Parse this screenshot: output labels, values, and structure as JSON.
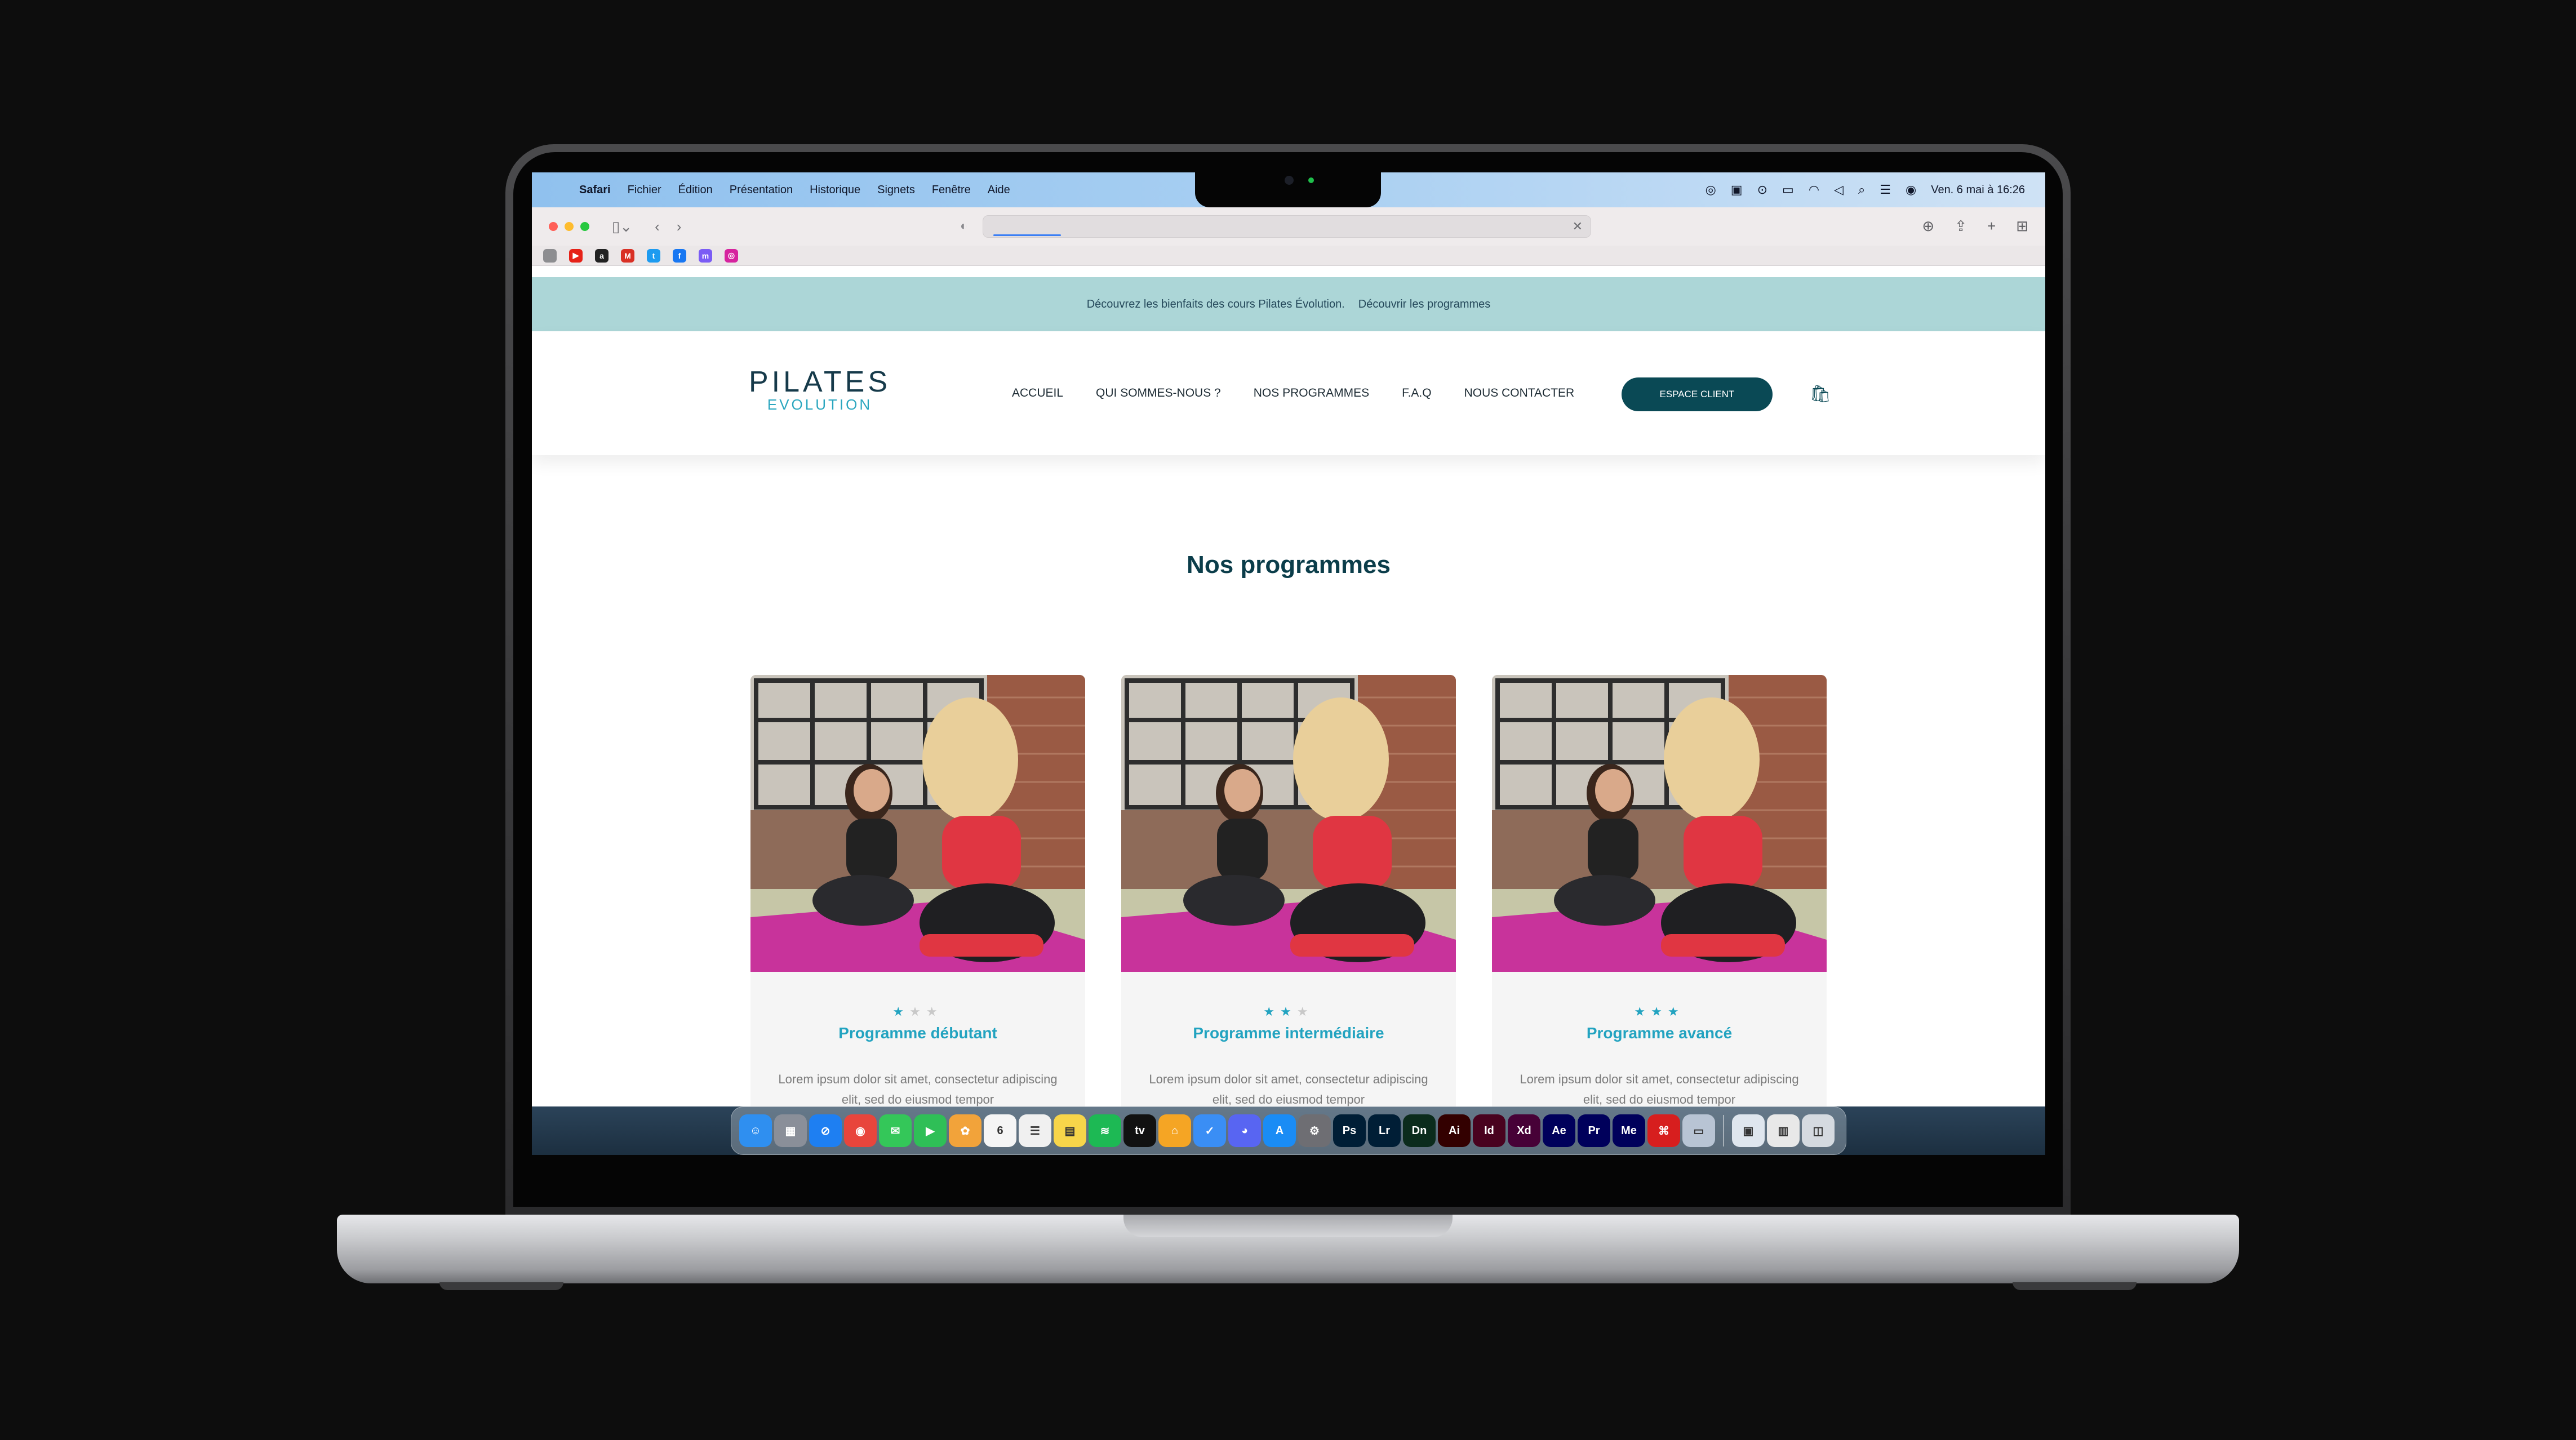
{
  "menubar": {
    "app": "Safari",
    "items": [
      "Fichier",
      "Édition",
      "Présentation",
      "Historique",
      "Signets",
      "Fenêtre",
      "Aide"
    ],
    "clock": "Ven. 6 mai à  16:26"
  },
  "favorites": [
    {
      "name": "apple-favorite",
      "glyph": "",
      "color": "#8d8d90"
    },
    {
      "name": "youtube-favorite",
      "glyph": "▶",
      "color": "#e62117"
    },
    {
      "name": "amazon-favorite",
      "glyph": "a",
      "color": "#222222"
    },
    {
      "name": "gmail-favorite",
      "glyph": "M",
      "color": "#d93025"
    },
    {
      "name": "twitter-favorite",
      "glyph": "t",
      "color": "#1d9bf0"
    },
    {
      "name": "facebook-favorite",
      "glyph": "f",
      "color": "#1877f2"
    },
    {
      "name": "messenger-favorite",
      "glyph": "m",
      "color": "#7b5cf5"
    },
    {
      "name": "instagram-favorite",
      "glyph": "◎",
      "color": "#d6249f"
    }
  ],
  "announcement": {
    "text": "Découvrez les bienfaits des cours Pilates Évolution.",
    "link": "Découvrir les programmes"
  },
  "header": {
    "logo_main": "PILATES",
    "logo_sub": "EVOLUTION",
    "nav": [
      "ACCUEIL",
      "QUI SOMMES-NOUS ?",
      "NOS PROGRAMMES",
      "F.A.Q",
      "NOUS CONTACTER"
    ],
    "cta": "ESPACE CLIENT"
  },
  "section": {
    "title": "Nos programmes"
  },
  "programs": [
    {
      "title": "Programme débutant",
      "stars": "★",
      "stars_off": "★★",
      "level": 1,
      "text": "Lorem ipsum dolor sit amet, consectetur adipiscing elit, sed do eiusmod tempor"
    },
    {
      "title": "Programme intermédiaire",
      "stars": "★★",
      "stars_off": "★",
      "level": 2,
      "text": "Lorem ipsum dolor sit amet, consectetur adipiscing elit, sed do eiusmod tempor"
    },
    {
      "title": "Programme avancé",
      "stars": "★★★",
      "stars_off": "",
      "level": 3,
      "text": "Lorem ipsum dolor sit amet, consectetur adipiscing elit, sed do eiusmod tempor"
    }
  ],
  "dock": [
    {
      "name": "finder",
      "label": "☺",
      "color": "#2f8ff0"
    },
    {
      "name": "launchpad",
      "label": "▦",
      "color": "#8a8f99"
    },
    {
      "name": "safari",
      "label": "⊘",
      "color": "#1e7ff2"
    },
    {
      "name": "chrome",
      "label": "◉",
      "color": "#e8453c"
    },
    {
      "name": "messages",
      "label": "✉",
      "color": "#34c759"
    },
    {
      "name": "facetime",
      "label": "▶",
      "color": "#2fbf57"
    },
    {
      "name": "photos",
      "label": "✿",
      "color": "#f2a33a"
    },
    {
      "name": "calendar",
      "label": "6",
      "color": "#f5f5f5"
    },
    {
      "name": "reminders",
      "label": "☰",
      "color": "#f0f0f0"
    },
    {
      "name": "notes",
      "label": "▤",
      "color": "#f7d54a"
    },
    {
      "name": "spotify",
      "label": "≋",
      "color": "#1db954"
    },
    {
      "name": "apple-tv",
      "label": "tv",
      "color": "#111111"
    },
    {
      "name": "home",
      "label": "⌂",
      "color": "#f5a524"
    },
    {
      "name": "tasks",
      "label": "✓",
      "color": "#3a8ef5"
    },
    {
      "name": "discord",
      "label": "◕",
      "color": "#5865f2"
    },
    {
      "name": "app-store",
      "label": "A",
      "color": "#1a8cf5"
    },
    {
      "name": "system-settings",
      "label": "⚙",
      "color": "#6e6e73"
    },
    {
      "name": "photoshop",
      "label": "Ps",
      "color": "#001e36"
    },
    {
      "name": "lightroom",
      "label": "Lr",
      "color": "#001e36"
    },
    {
      "name": "dimension",
      "label": "Dn",
      "color": "#0b2b1c"
    },
    {
      "name": "illustrator",
      "label": "Ai",
      "color": "#330000"
    },
    {
      "name": "indesign",
      "label": "Id",
      "color": "#49021f"
    },
    {
      "name": "xd",
      "label": "Xd",
      "color": "#470137"
    },
    {
      "name": "after-effects",
      "label": "Ae",
      "color": "#00005b"
    },
    {
      "name": "premiere",
      "label": "Pr",
      "color": "#00005b"
    },
    {
      "name": "media-encoder",
      "label": "Me",
      "color": "#00005b"
    },
    {
      "name": "acrobat",
      "label": "⌘",
      "color": "#d71e1e"
    },
    {
      "name": "preview",
      "label": "▭",
      "color": "#b8c4d4"
    },
    {
      "name": "downloads",
      "label": "▣",
      "color": "#dfe6ee"
    },
    {
      "name": "folder",
      "label": "▥",
      "color": "#e8e8e8"
    },
    {
      "name": "trash",
      "label": "◫",
      "color": "#d5dae0"
    }
  ]
}
